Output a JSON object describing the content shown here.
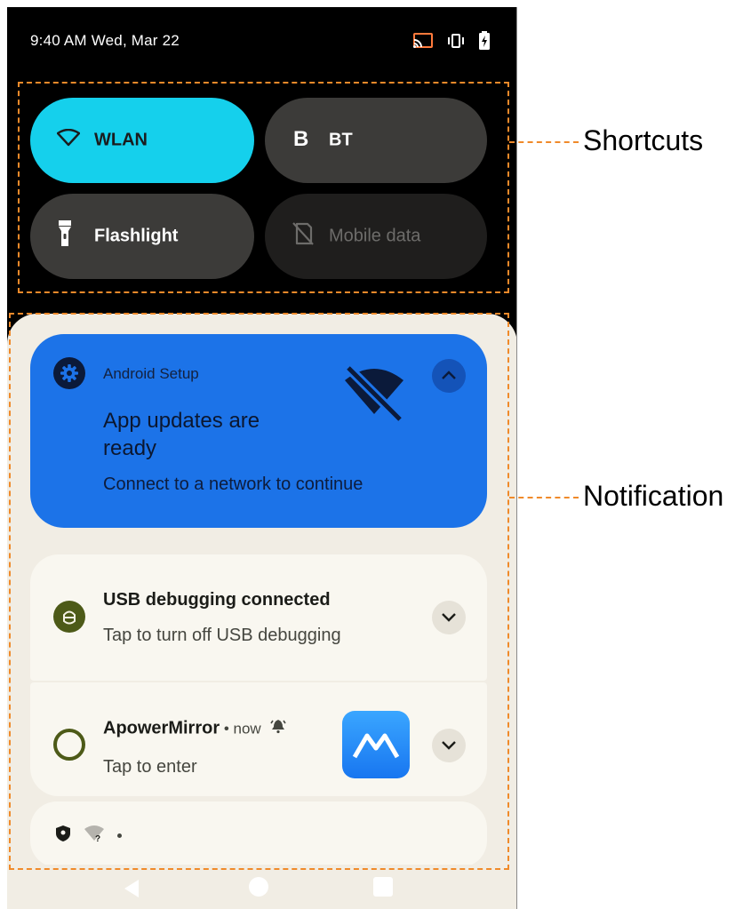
{
  "status_bar": {
    "time_date": "9:40 AM Wed, Mar 22",
    "icons": [
      "cast-icon",
      "vibrate-icon",
      "battery-charging-icon"
    ]
  },
  "quick_settings": {
    "tiles": [
      {
        "label": "WLAN",
        "icon": "wifi-icon",
        "state": "on"
      },
      {
        "label": "BT",
        "icon": "bluetooth-icon",
        "state": "off"
      },
      {
        "label": "Flashlight",
        "icon": "flashlight-icon",
        "state": "off"
      },
      {
        "label": "Mobile data",
        "icon": "mobile-data-off-icon",
        "state": "unavailable"
      }
    ]
  },
  "notifications": {
    "setup": {
      "app": "Android Setup",
      "title": "App updates are ready",
      "text": "Connect to a network to continue"
    },
    "usb": {
      "title": "USB debugging connected",
      "text": "Tap to turn off USB debugging"
    },
    "apower": {
      "title": "ApowerMirror",
      "meta": " • now",
      "text": "Tap to enter"
    },
    "mini": {
      "icons": [
        "shield-icon",
        "wifi-unknown-icon"
      ],
      "separator": "•"
    }
  },
  "annotations": {
    "shortcuts": "Shortcuts",
    "notification": "Notification"
  },
  "colors": {
    "wlan_tile": "#15d0ec",
    "setup_card": "#1c73e8",
    "annotation_dash": "#f08a2a"
  }
}
